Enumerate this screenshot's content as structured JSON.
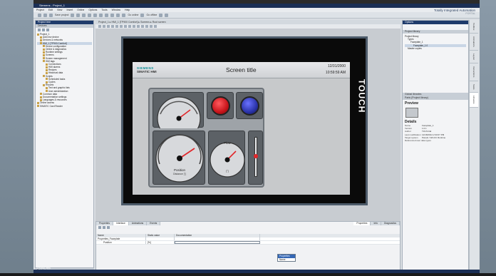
{
  "app": {
    "title": "Siemens - Project_1",
    "brand_line1": "Totally Integrated Automation",
    "brand_line2": "PORTAL"
  },
  "menu": [
    "Project",
    "Edit",
    "View",
    "Insert",
    "Online",
    "Options",
    "Tools",
    "Window",
    "Help"
  ],
  "toolbar": {
    "save_label": "Save project",
    "go_online_label": "Go online",
    "go_offline_label": "Go offline"
  },
  "tree": {
    "header": "Project tree",
    "devices_tab": "Devices",
    "items": [
      "Project_1",
      "Add new device",
      "Devices & networks",
      "HMI_1 [TP900 Comfort]",
      "Device configuration",
      "Online & diagnostics",
      "Runtime settings",
      "Screens",
      "Screen management",
      "HMI tags",
      "Connections",
      "HMI alarms",
      "Recipes",
      "Historical data",
      "Scripts",
      "Scheduled tasks",
      "Cycles",
      "Reports",
      "Text and graphic lists",
      "User administration",
      "Common data",
      "Documentation settings",
      "Languages & resources",
      "Online access",
      "SIMATIC Card Reader"
    ],
    "details_view": "Details view"
  },
  "editor": {
    "breadcrumb": "Project_1 ▸ HMI_1 [TP900 Comfort] ▸ Screens ▸ Root screen"
  },
  "hmi": {
    "logo_top": "SIEMENS",
    "logo_bottom": "SIMATIC HMI",
    "screen_title": "Screen title",
    "date": "12/31/2000",
    "time": "10:59:59 AM",
    "touch_label": "TOUCH",
    "gauge_position_label": "Position",
    "gauge_position_unit": "Distance [\"]",
    "gauge_flow_label": "Flow",
    "gauge_flow_unit": "[°]"
  },
  "inspector": {
    "tabs": [
      "Properties",
      "Interface",
      "Animations",
      "Events"
    ],
    "active_tab": "Interface",
    "right_tabs": [
      "Properties",
      "Info",
      "Diagnostics"
    ],
    "columns": [
      "Name",
      "Static value",
      "Documentation"
    ],
    "rows": [
      {
        "name": "Properties_Faceplate",
        "value": "",
        "doc": ""
      },
      {
        "name": "Position",
        "value": "[%]",
        "doc": ""
      }
    ],
    "dropdown": [
      "Properties",
      "Name"
    ]
  },
  "task": {
    "options_header": "Options",
    "library_header": "Project library",
    "library_items": [
      "Project library",
      "Types",
      "Faceplate_1",
      "Faceplate_1.0",
      "Master copies"
    ],
    "global_libraries": "Global libraries",
    "parts_header": "Parts (Project library)",
    "preview_title": "Preview",
    "details_title": "Details",
    "details": [
      {
        "k": "Name",
        "v": "Faceplate_1"
      },
      {
        "k": "Version",
        "v": "1.0.1"
      },
      {
        "k": "Author",
        "v": "TIA Portal"
      },
      {
        "k": "Last modification",
        "v": "12/18/2014 2:33:07 PM"
      },
      {
        "k": "Target system",
        "v": "Panels / WinCC Runtime"
      },
      {
        "k": "Referenced user data types",
        "v": ""
      }
    ]
  },
  "sidetabs": [
    "Toolbox",
    "Animations",
    "Layout",
    "Instructions",
    "Tasks",
    "Libraries"
  ],
  "portal_view": "◂ Portal view",
  "colors": {
    "title_blue": "#1b2f55",
    "siemens_teal": "#0b8e96",
    "indicator_red": "#c8141a",
    "indicator_blue": "#2a33a8",
    "needle_red": "#e1262a"
  }
}
